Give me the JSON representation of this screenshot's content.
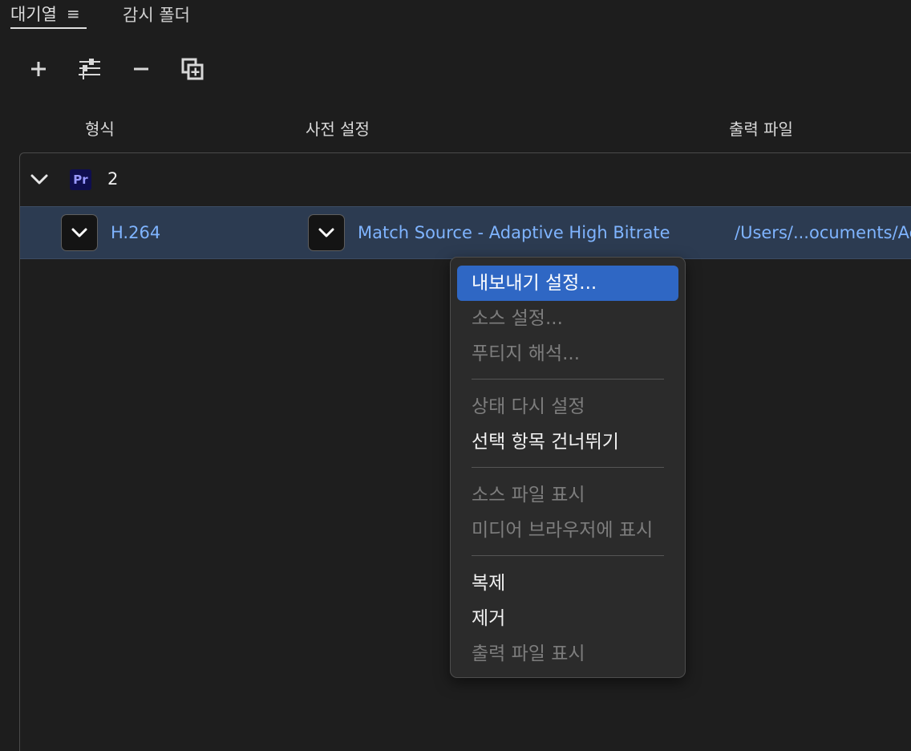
{
  "tabs": {
    "queue_label": "대기열",
    "queue_menu_glyph": "≡",
    "watch_label": "감시 폴더"
  },
  "toolbar": {
    "add_icon": "plus-icon",
    "settings_icon": "sliders-icon",
    "remove_icon": "minus-icon",
    "duplicate_icon": "duplicate-icon"
  },
  "columns": {
    "format": "형식",
    "preset": "사전 설정",
    "output": "출력 파일"
  },
  "queue": {
    "group": {
      "badge": "Pr",
      "count": "2"
    },
    "item": {
      "format": "H.264",
      "preset": "Match Source - Adaptive High Bitrate",
      "output": "/Users/...ocuments/Adobe"
    }
  },
  "context_menu": {
    "export_settings": "내보내기 설정...",
    "source_settings": "소스 설정...",
    "interpret_footage": "푸티지 해석...",
    "reset_status": "상태 다시 설정",
    "skip_selection": "선택 항목 건너뛰기",
    "reveal_source": "소스 파일 표시",
    "reveal_media_browser": "미디어 브라우저에 표시",
    "duplicate": "복제",
    "remove": "제거",
    "reveal_output": "출력 파일 표시"
  },
  "colors": {
    "accent": "#2f67c4",
    "link": "#7fb4ff",
    "selected_row": "#2c3b51"
  }
}
